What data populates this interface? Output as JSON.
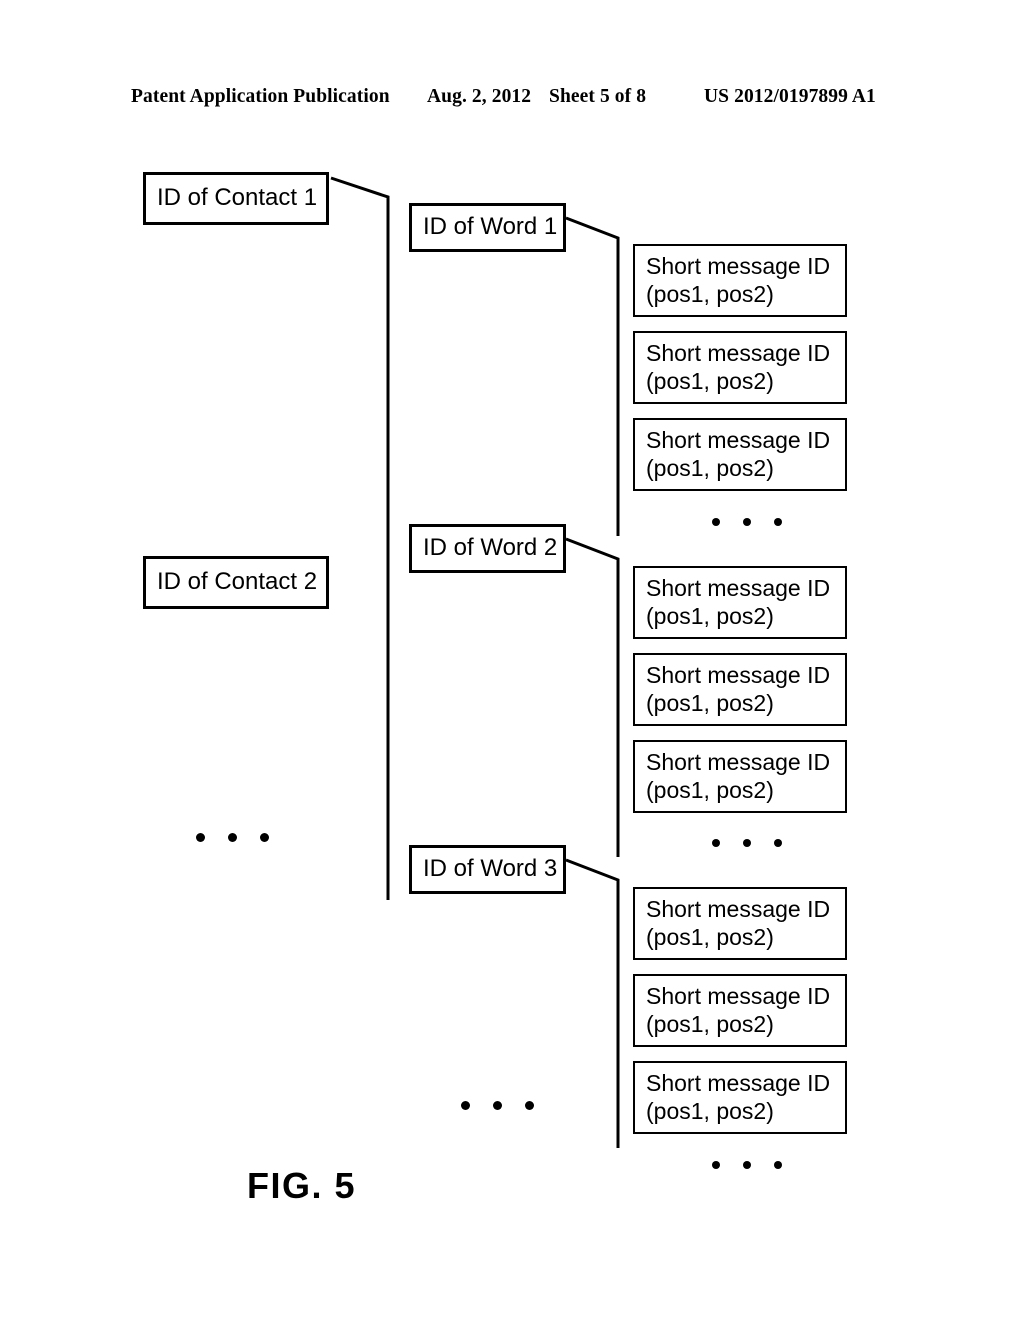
{
  "header": {
    "publication": "Patent Application Publication",
    "date": "Aug. 2, 2012",
    "sheet": "Sheet 5 of 8",
    "patent_number": "US 2012/0197899 A1"
  },
  "figure": {
    "caption": "FIG. 5",
    "ellipsis": "• • •"
  },
  "contacts": [
    {
      "label": "ID of Contact 1"
    },
    {
      "label": "ID of Contact 2"
    }
  ],
  "words": [
    {
      "label": "ID of Word 1"
    },
    {
      "label": "ID of Word 2"
    },
    {
      "label": "ID of Word 3"
    }
  ],
  "messages": {
    "line1": "Short message ID",
    "line2": "(pos1, pos2)",
    "groups": [
      {
        "word_ref": "ID of Word 1",
        "items": [
          {
            "line1": "Short message ID",
            "line2": "(pos1, pos2)"
          },
          {
            "line1": "Short message ID",
            "line2": "(pos1, pos2)"
          },
          {
            "line1": "Short message ID",
            "line2": "(pos1, pos2)"
          }
        ]
      },
      {
        "word_ref": "ID of Word 2",
        "items": [
          {
            "line1": "Short message ID",
            "line2": "(pos1, pos2)"
          },
          {
            "line1": "Short message ID",
            "line2": "(pos1, pos2)"
          },
          {
            "line1": "Short message ID",
            "line2": "(pos1, pos2)"
          }
        ]
      },
      {
        "word_ref": "ID of Word 3",
        "items": [
          {
            "line1": "Short message ID",
            "line2": "(pos1, pos2)"
          },
          {
            "line1": "Short message ID",
            "line2": "(pos1, pos2)"
          },
          {
            "line1": "Short message ID",
            "line2": "(pos1, pos2)"
          }
        ]
      }
    ]
  },
  "colors": {
    "ink": "#000000",
    "paper": "#ffffff"
  }
}
